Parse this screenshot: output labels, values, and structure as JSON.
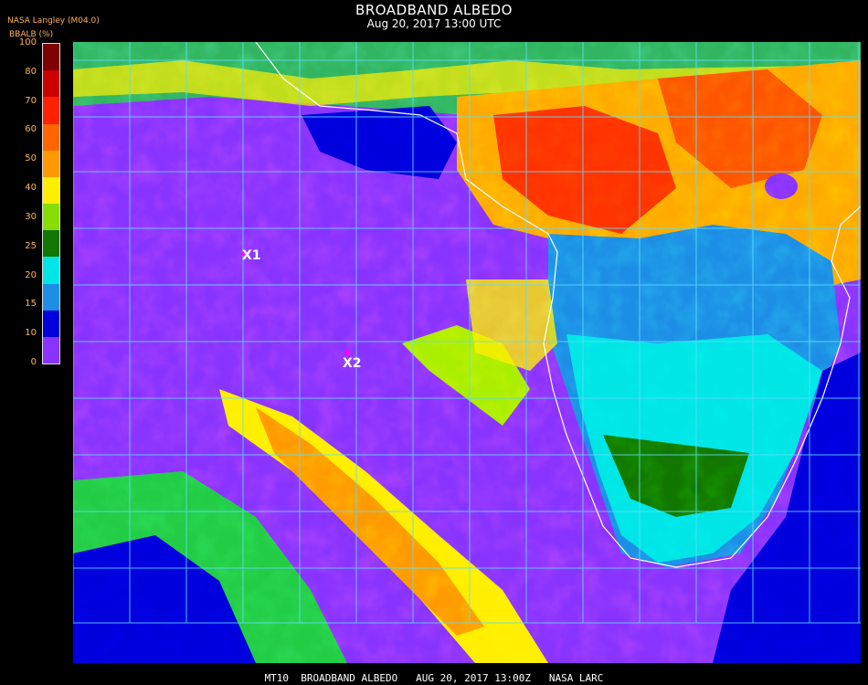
{
  "header": {
    "title": "BROADBAND ALBEDO",
    "subtitle": "Aug 20, 2017 13:00 UTC",
    "producer": "NASA Langley (M04.0)",
    "unit": "BBALB (%)"
  },
  "legend": {
    "ticks": [
      "100",
      "80",
      "70",
      "60",
      "50",
      "40",
      "30",
      "25",
      "20",
      "15",
      "10",
      "0"
    ],
    "colors": [
      "#7f0000",
      "#cc0000",
      "#ff2200",
      "#ff6600",
      "#ff9900",
      "#ffee00",
      "#88dd00",
      "#117700",
      "#00e5e5",
      "#1c8ee6",
      "#0000dd",
      "#8833ff"
    ]
  },
  "map": {
    "markers": [
      "X1",
      "X2"
    ],
    "grid_color": "#5fdcff",
    "coast_color": "#ffffff"
  },
  "footer": {
    "text": "MT10  BROADBAND ALBEDO   AUG 20, 2017 13:00Z   NASA LARC"
  }
}
